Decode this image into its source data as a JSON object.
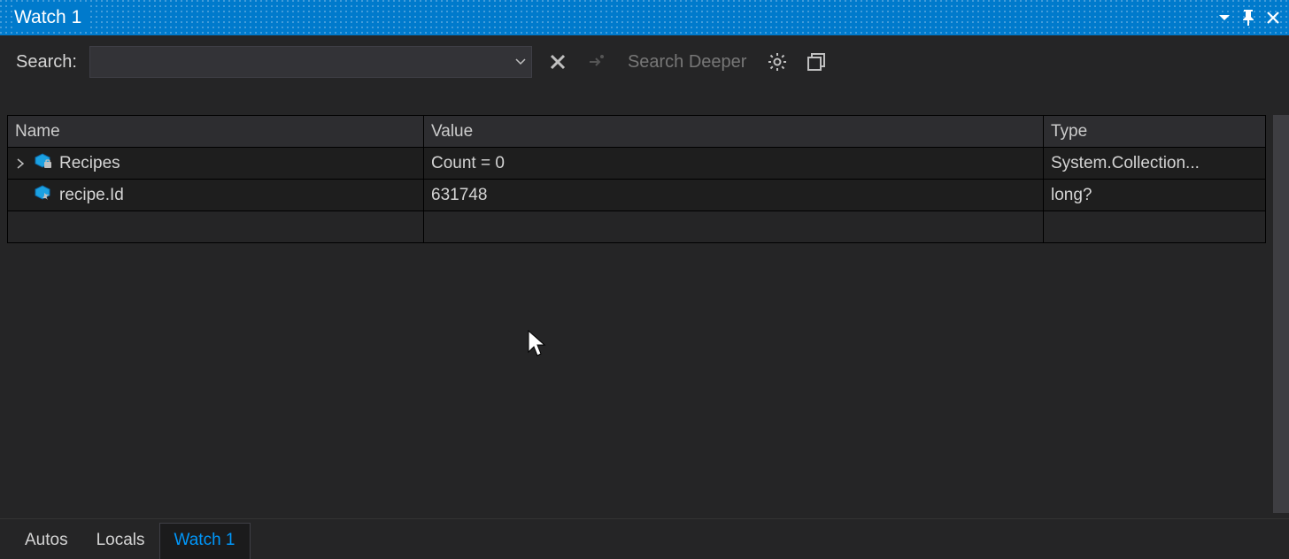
{
  "title": "Watch 1",
  "toolbar": {
    "search_label": "Search:",
    "search_value": "",
    "search_deeper_label": "Search Deeper"
  },
  "columns": {
    "name": "Name",
    "value": "Value",
    "type": "Type"
  },
  "rows": [
    {
      "expandable": true,
      "icon": "property-lock",
      "name": "Recipes",
      "value": "Count = 0",
      "type": "System.Collection..."
    },
    {
      "expandable": false,
      "icon": "property-fav",
      "name": "recipe.Id",
      "value": "631748",
      "type": "long?"
    }
  ],
  "tabs": [
    {
      "label": "Autos",
      "active": false
    },
    {
      "label": "Locals",
      "active": false
    },
    {
      "label": "Watch 1",
      "active": true
    }
  ]
}
